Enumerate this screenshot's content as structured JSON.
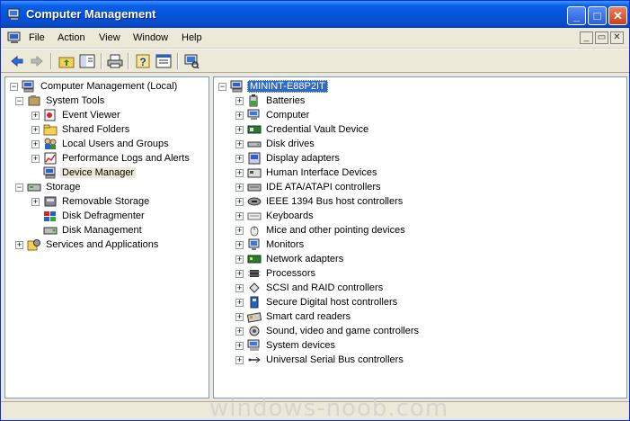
{
  "window": {
    "title": "Computer Management",
    "minimize_glyph": "_",
    "maximize_glyph": "□",
    "close_glyph": "✕"
  },
  "menubar": {
    "items": [
      "File",
      "Action",
      "View",
      "Window",
      "Help"
    ]
  },
  "left_tree": [
    {
      "label": "Computer Management (Local)",
      "icon": "computer-management-icon",
      "expander": "minus"
    },
    {
      "label": "System Tools",
      "icon": "system-tools-icon",
      "expander": "minus"
    },
    {
      "label": "Event Viewer",
      "icon": "event-viewer-icon",
      "expander": "plus"
    },
    {
      "label": "Shared Folders",
      "icon": "shared-folders-icon",
      "expander": "plus"
    },
    {
      "label": "Local Users and Groups",
      "icon": "users-groups-icon",
      "expander": "plus"
    },
    {
      "label": "Performance Logs and Alerts",
      "icon": "performance-icon",
      "expander": "plus"
    },
    {
      "label": "Device Manager",
      "icon": "device-manager-icon",
      "expander": "none",
      "highlight": true
    },
    {
      "label": "Storage",
      "icon": "storage-icon",
      "expander": "minus"
    },
    {
      "label": "Removable Storage",
      "icon": "removable-storage-icon",
      "expander": "plus"
    },
    {
      "label": "Disk Defragmenter",
      "icon": "defragmenter-icon",
      "expander": "none"
    },
    {
      "label": "Disk Management",
      "icon": "disk-management-icon",
      "expander": "none"
    },
    {
      "label": "Services and Applications",
      "icon": "services-icon",
      "expander": "plus"
    }
  ],
  "right_tree": {
    "root": "MININT-E88P2IT",
    "items": [
      "Batteries",
      "Computer",
      "Credential Vault Device",
      "Disk drives",
      "Display adapters",
      "Human Interface Devices",
      "IDE ATA/ATAPI controllers",
      "IEEE 1394 Bus host controllers",
      "Keyboards",
      "Mice and other pointing devices",
      "Monitors",
      "Network adapters",
      "Processors",
      "SCSI and RAID controllers",
      "Secure Digital host controllers",
      "Smart card readers",
      "Sound, video and game controllers",
      "System devices",
      "Universal Serial Bus controllers"
    ]
  },
  "watermark": "windows-noob.com",
  "colors": {
    "titlebar": "#0453d9",
    "selection": "#316ac5",
    "chrome": "#ece9d8"
  }
}
